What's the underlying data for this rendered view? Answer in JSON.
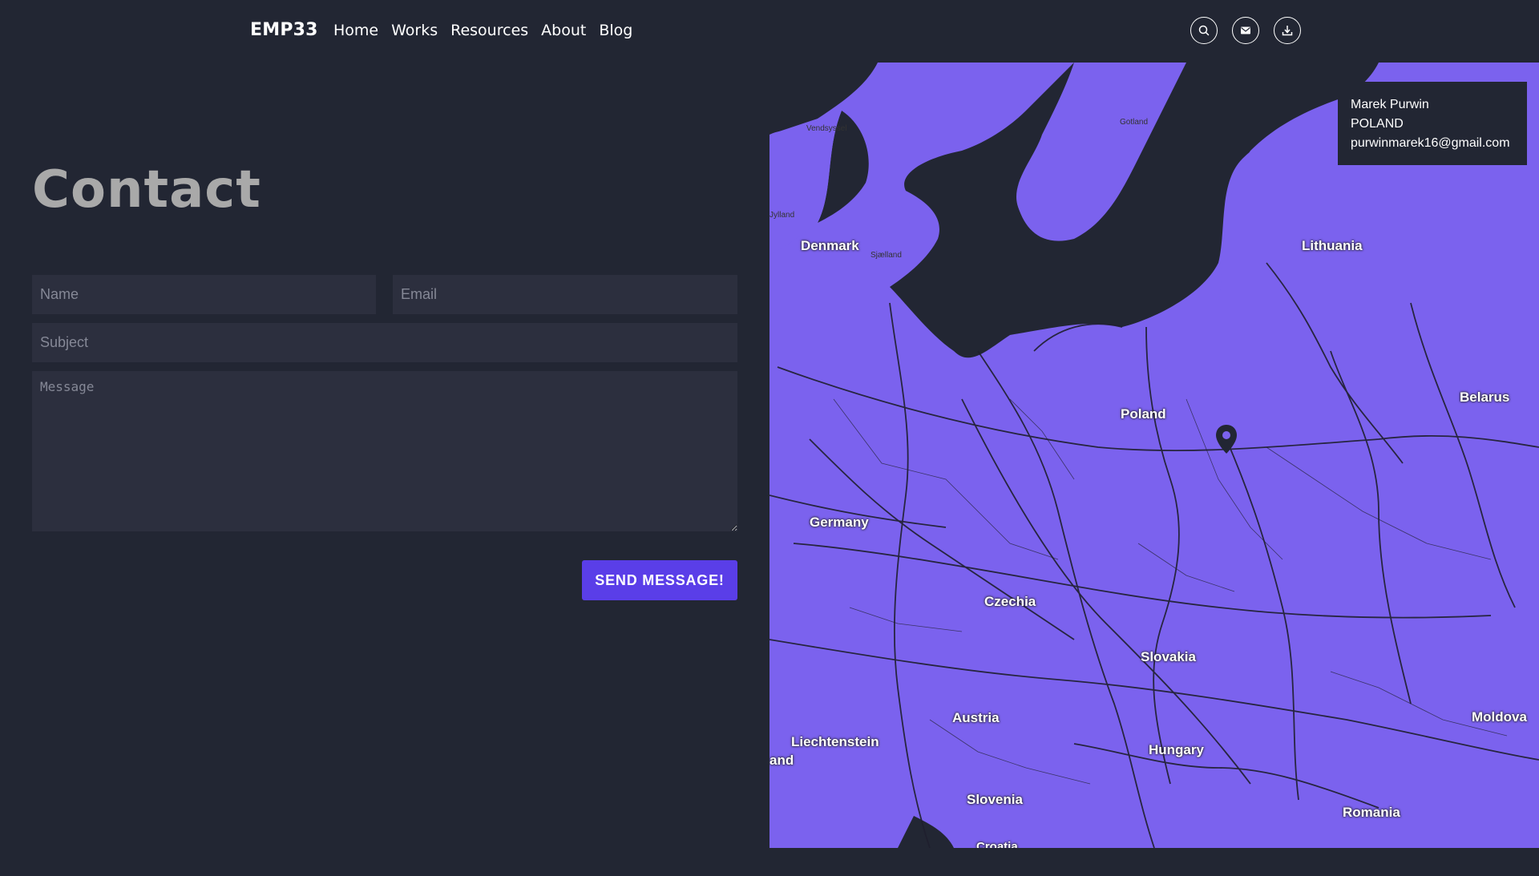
{
  "nav": {
    "brand": "EMP33",
    "items": [
      "Home",
      "Works",
      "Resources",
      "About",
      "Blog"
    ],
    "icons": [
      "search-icon",
      "mail-icon",
      "download-icon"
    ]
  },
  "contact": {
    "title": "Contact",
    "name_placeholder": "Name",
    "email_placeholder": "Email",
    "subject_placeholder": "Subject",
    "message_placeholder": "Message",
    "send_label": "SEND MESSAGE!"
  },
  "map": {
    "info": {
      "name": "Marek Purwin",
      "country": "POLAND",
      "email": "purwinmarek16@gmail.com"
    },
    "labels": {
      "denmark": "Denmark",
      "lithuania": "Lithuania",
      "belarus": "Belarus",
      "poland": "Poland",
      "germany": "Germany",
      "czechia": "Czechia",
      "slovakia": "Slovakia",
      "austria": "Austria",
      "liechtenstein": "Liechtenstein",
      "hungary": "Hungary",
      "moldova": "Moldova",
      "slovenia": "Slovenia",
      "romania": "Romania",
      "croatia": "Croatia",
      "land": "and",
      "vendsyssel": "Vendsyssel",
      "gotland": "Gotland",
      "sjaelland": "Sjælland",
      "jylland": "Jylland"
    },
    "colors": {
      "land": "#7b62ee",
      "sea": "#222633",
      "roads": "#1f1f2e"
    }
  },
  "colors": {
    "background": "#222633",
    "accent": "#5a3ee8",
    "field": "#2c2f3e",
    "title": "#a9a9a9"
  }
}
